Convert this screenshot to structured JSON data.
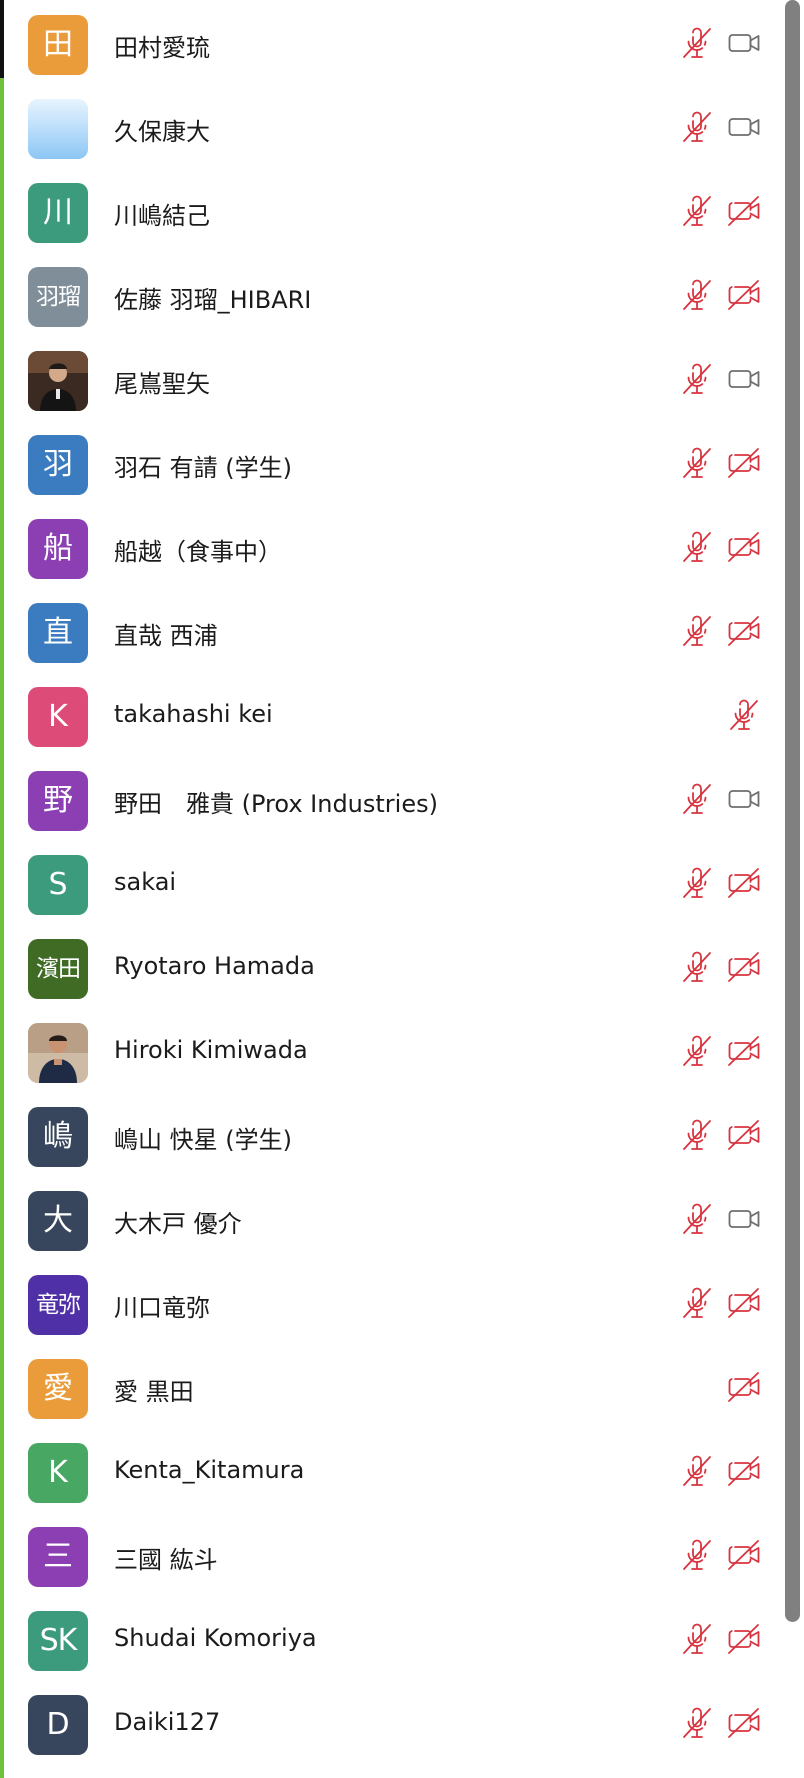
{
  "colors": {
    "muted_red": "#d8343f",
    "camera_gray": "#6e6e6e",
    "active_strip": "#6fc13b",
    "scrollbar": "#808080"
  },
  "participants": [
    {
      "name": "田村愛琉",
      "initial": "田",
      "avatar_color": "#eb9c3a",
      "mic": "muted",
      "camera": "on"
    },
    {
      "name": "久保康大",
      "initial": "",
      "avatar_color": "#a9d4f5",
      "avatar_kind": "photo-sky",
      "mic": "muted",
      "camera": "on"
    },
    {
      "name": "川嶋結己",
      "initial": "川",
      "avatar_color": "#3d9b7d",
      "mic": "muted",
      "camera": "off"
    },
    {
      "name": "佐藤 羽瑠_HIBARI",
      "initial": "羽瑠",
      "avatar_color": "#7f8e99",
      "mic": "muted",
      "camera": "off"
    },
    {
      "name": "尾嶌聖矢",
      "initial": "",
      "avatar_color": "#2a2a2a",
      "avatar_kind": "photo-person-dark",
      "mic": "muted",
      "camera": "on"
    },
    {
      "name": "羽石 有請 (学生)",
      "initial": "羽",
      "avatar_color": "#3a7cbf",
      "mic": "muted",
      "camera": "off"
    },
    {
      "name": "船越（食事中）",
      "initial": "船",
      "avatar_color": "#8c3fb3",
      "mic": "muted",
      "camera": "off"
    },
    {
      "name": "直哉 西浦",
      "initial": "直",
      "avatar_color": "#3a7cbf",
      "mic": "muted",
      "camera": "off"
    },
    {
      "name": "takahashi kei",
      "initial": "K",
      "avatar_color": "#dd4b79",
      "mic": "muted-only",
      "camera": "none"
    },
    {
      "name": "野田　雅貴 (Prox Industries)",
      "initial": "野",
      "avatar_color": "#8c3fb3",
      "mic": "muted",
      "camera": "on"
    },
    {
      "name": "sakai",
      "initial": "S",
      "avatar_color": "#3d9b7d",
      "mic": "muted",
      "camera": "off"
    },
    {
      "name": "Ryotaro Hamada",
      "initial": "濱田",
      "avatar_color": "#3f6b25",
      "mic": "muted",
      "camera": "off"
    },
    {
      "name": "Hiroki Kimiwada",
      "initial": "",
      "avatar_color": "#c7b7a3",
      "avatar_kind": "photo-person-light",
      "mic": "muted",
      "camera": "off"
    },
    {
      "name": "嶋山 快星 (学生)",
      "initial": "嶋",
      "avatar_color": "#37465c",
      "mic": "muted",
      "camera": "off"
    },
    {
      "name": "大木戸 優介",
      "initial": "大",
      "avatar_color": "#37465c",
      "mic": "muted",
      "camera": "on"
    },
    {
      "name": "川口竜弥",
      "initial": "竜弥",
      "avatar_color": "#5030a6",
      "mic": "muted",
      "camera": "off"
    },
    {
      "name": "愛 黒田",
      "initial": "愛",
      "avatar_color": "#eb9c3a",
      "mic": "none",
      "camera": "off"
    },
    {
      "name": "Kenta_Kitamura",
      "initial": "K",
      "avatar_color": "#48a863",
      "mic": "muted",
      "camera": "off"
    },
    {
      "name": "三國 紘斗",
      "initial": "三",
      "avatar_color": "#8c3fb3",
      "mic": "muted",
      "camera": "off"
    },
    {
      "name": "Shudai Komoriya",
      "initial": "SK",
      "avatar_color": "#3d9b7d",
      "mic": "muted",
      "camera": "off"
    },
    {
      "name": "Daiki127",
      "initial": "D",
      "avatar_color": "#37465c",
      "mic": "muted",
      "camera": "off"
    }
  ]
}
